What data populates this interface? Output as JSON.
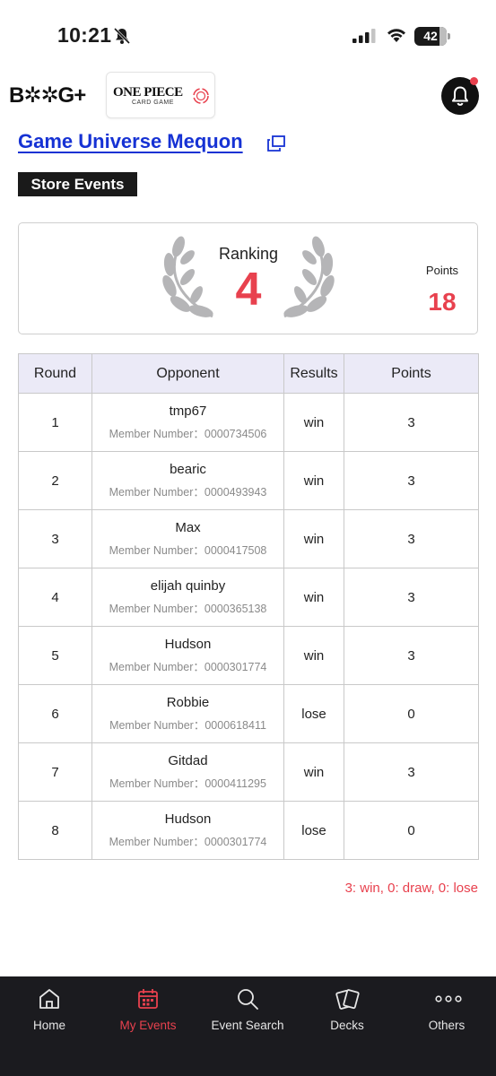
{
  "status_bar": {
    "time": "10:21",
    "battery": "42"
  },
  "header": {
    "brand": "B✲✲G+",
    "logo_main": "ONE PIECE",
    "logo_sub": "CARD GAME"
  },
  "store": {
    "name": "Game Universe Mequon",
    "section": "Store Events"
  },
  "ranking": {
    "label": "Ranking",
    "value": "4",
    "points_label": "Points",
    "points_value": "18"
  },
  "table": {
    "headers": {
      "round": "Round",
      "opponent": "Opponent",
      "results": "Results",
      "points": "Points"
    },
    "rows": [
      {
        "round": "1",
        "name": "tmp67",
        "member": "Member Number：0000734506",
        "result": "win",
        "points": "3"
      },
      {
        "round": "2",
        "name": "bearic",
        "member": "Member Number：0000493943",
        "result": "win",
        "points": "3"
      },
      {
        "round": "3",
        "name": "Max",
        "member": "Member Number：0000417508",
        "result": "win",
        "points": "3"
      },
      {
        "round": "4",
        "name": "elijah quinby",
        "member": "Member Number：0000365138",
        "result": "win",
        "points": "3"
      },
      {
        "round": "5",
        "name": "Hudson",
        "member": "Member Number：0000301774",
        "result": "win",
        "points": "3"
      },
      {
        "round": "6",
        "name": "Robbie",
        "member": "Member Number：0000618411",
        "result": "lose",
        "points": "0"
      },
      {
        "round": "7",
        "name": "Gitdad",
        "member": "Member Number：0000411295",
        "result": "win",
        "points": "3"
      },
      {
        "round": "8",
        "name": "Hudson",
        "member": "Member Number：0000301774",
        "result": "lose",
        "points": "0"
      }
    ]
  },
  "legend": "3: win, 0: draw, 0: lose",
  "nav": {
    "home": "Home",
    "my_events": "My Events",
    "event_search": "Event Search",
    "decks": "Decks",
    "others": "Others"
  },
  "colors": {
    "accent": "#e8414e",
    "link": "#1632d4",
    "nav_bg": "#1b1b1f",
    "table_header": "#ebeaf7"
  }
}
